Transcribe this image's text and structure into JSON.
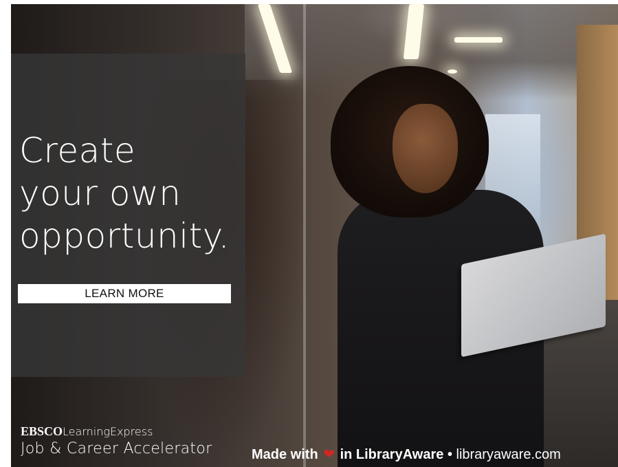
{
  "hero": {
    "headline_lines": [
      "Create",
      "your own",
      "opportunity."
    ],
    "cta_label": "LEARN MORE"
  },
  "brand": {
    "company": "EBSCO",
    "product_line": "LearningExpress",
    "product_name": "Job & Career Accelerator"
  },
  "footer": {
    "made_with": "Made with",
    "heart_icon": "heart-icon",
    "in_text": "in LibraryAware",
    "bullet": "•",
    "site": "libraryaware.com"
  },
  "colors": {
    "heart": "#d3261f",
    "panel_overlay": "rgba(55,55,55,0.78)",
    "text": "#ffffff"
  }
}
